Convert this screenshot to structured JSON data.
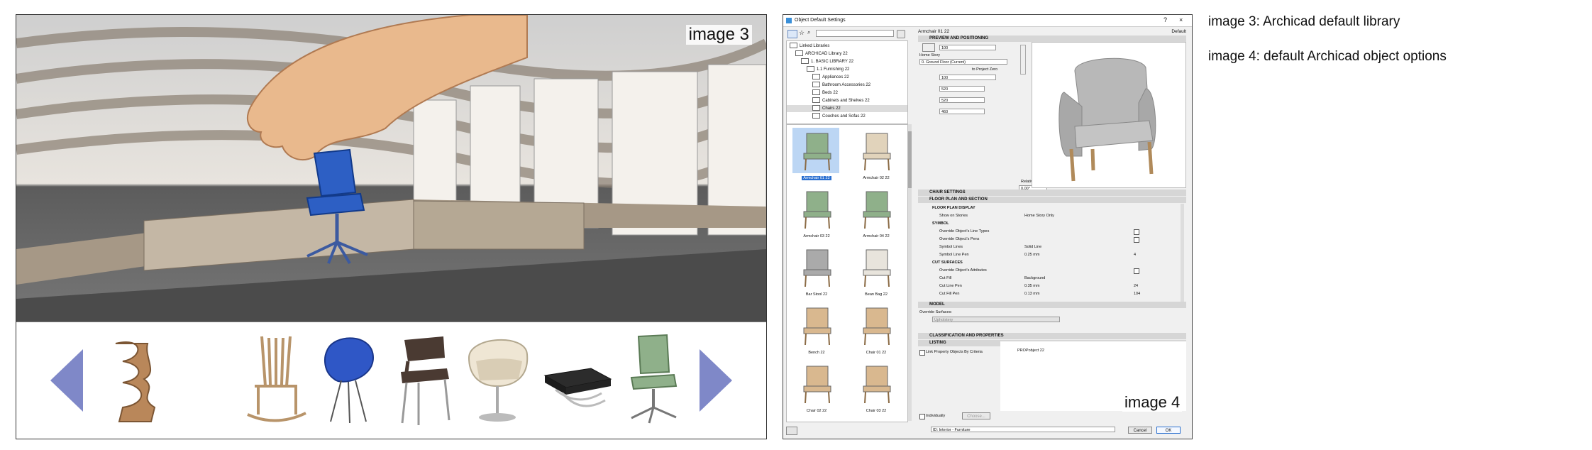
{
  "image3": {
    "label": "image 3"
  },
  "image4": {
    "label": "image 4",
    "window_title": "Object Default Settings",
    "help": "?",
    "close": "×",
    "search_placeholder": "",
    "tree": [
      {
        "label": "Linked Libraries",
        "indent": 0
      },
      {
        "label": "ARCHICAD Library 22",
        "indent": 1
      },
      {
        "label": "1. BASIC LIBRARY 22",
        "indent": 2
      },
      {
        "label": "1.1 Furnishing 22",
        "indent": 3
      },
      {
        "label": "Appliances 22",
        "indent": 4
      },
      {
        "label": "Bathroom Accessories 22",
        "indent": 4
      },
      {
        "label": "Beds 22",
        "indent": 4
      },
      {
        "label": "Cabinets and Shelves 22",
        "indent": 4
      },
      {
        "label": "Chairs 22",
        "indent": 4,
        "selected": true
      },
      {
        "label": "Couches and Sofas 22",
        "indent": 4
      }
    ],
    "objects": [
      {
        "name": "Armchair 01 22",
        "selected": true
      },
      {
        "name": "Armchair 02 22"
      },
      {
        "name": "Armchair 03 22"
      },
      {
        "name": "Armchair 04 22"
      },
      {
        "name": "Bar Stool 22"
      },
      {
        "name": "Bean Bag 22"
      },
      {
        "name": "Bench 22"
      },
      {
        "name": "Chair 01 22"
      },
      {
        "name": "Chair 02 22"
      },
      {
        "name": "Chair 03 22"
      }
    ],
    "header_name": "Armchair 01 22",
    "header_default": "Default",
    "sections": {
      "preview": "PREVIEW AND POSITIONING",
      "chair": "CHAIR SETTINGS",
      "floorplan": "FLOOR PLAN AND SECTION",
      "model": "MODEL",
      "classification": "CLASSIFICATION AND PROPERTIES",
      "listing": "LISTING"
    },
    "positioning": {
      "elevation": "100",
      "home_story_label": "Home Story",
      "home_story": "0. Ground Floor (Current)",
      "to_project_zero": "to Project Zero",
      "height_offset": "100",
      "dim1": "520",
      "dim2": "520",
      "dim3": "460",
      "relative": "Relative",
      "angle": "0.00°"
    },
    "floorplan_rows": [
      {
        "label": "FLOOR PLAN DISPLAY",
        "value": "",
        "extra": "",
        "bold": true
      },
      {
        "label": "Show on Stories",
        "value": "Home Story Only",
        "extra": ""
      },
      {
        "label": "SYMBOL",
        "value": "",
        "extra": "",
        "bold": true
      },
      {
        "label": "Override Object's Line Types",
        "value": "",
        "extra": ""
      },
      {
        "label": "Override Object's Pens",
        "value": "",
        "extra": ""
      },
      {
        "label": "Symbol Lines",
        "value": "Solid Line",
        "extra": ""
      },
      {
        "label": "Symbol Line Pen",
        "value": "0.25 mm",
        "extra": "4"
      },
      {
        "label": "CUT SURFACES",
        "value": "",
        "extra": "",
        "bold": true
      },
      {
        "label": "Override Object's Attributes",
        "value": "",
        "extra": ""
      },
      {
        "label": "Cut Fill",
        "value": "Background",
        "extra": ""
      },
      {
        "label": "Cut Line Pen",
        "value": "0.35 mm",
        "extra": "24"
      },
      {
        "label": "Cut Fill Pen",
        "value": "0.13 mm",
        "extra": "104"
      }
    ],
    "override_surfaces": "Override Surfaces:",
    "surfaces_select": "Upholstery",
    "link_property": "Link Property Objects By Criteria",
    "propobject": "PROPobject 22",
    "individually": "Individually",
    "choose": "Choose...",
    "layer": "ID: Interior - Furniture",
    "cancel": "Cancel",
    "ok": "OK"
  },
  "captions": {
    "image3": "image 3: Archicad default library",
    "image4": "image 4: default Archicad object options"
  }
}
